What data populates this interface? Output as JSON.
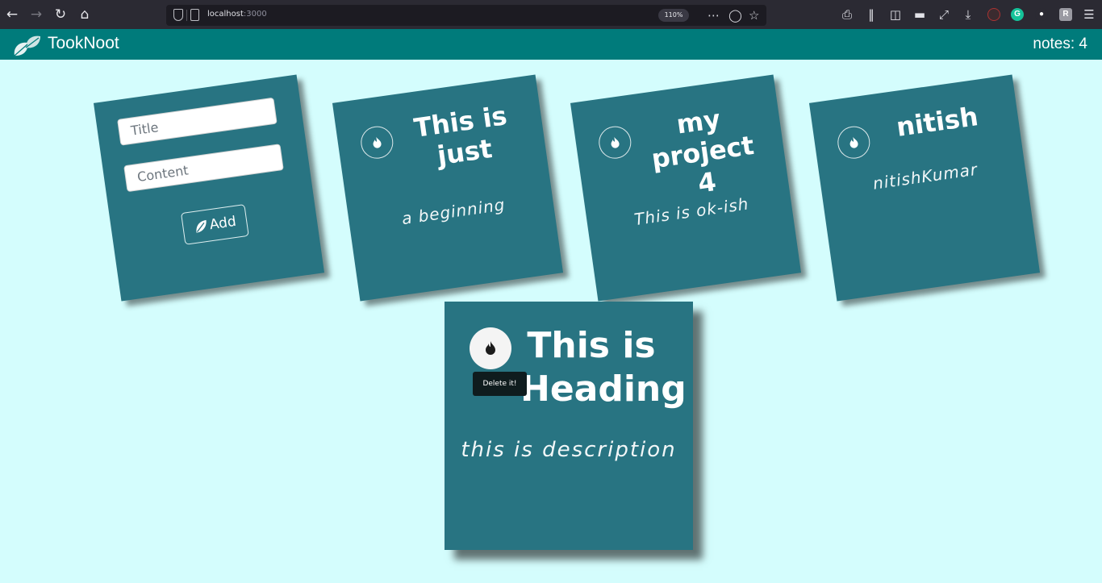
{
  "browser": {
    "url_host": "localhost",
    "url_port": ":3000",
    "zoom": "110%"
  },
  "app": {
    "title": "TookNoot",
    "notes_count": "notes: 4",
    "header_color": "#007b7b",
    "card_color": "#287482",
    "background_color": "#d4fdfd"
  },
  "form": {
    "title_placeholder": "Title",
    "content_placeholder": "Content",
    "add_label": "Add"
  },
  "notes": [
    {
      "title": "This is just",
      "content": "a beginning"
    },
    {
      "title": "my project 4",
      "content": "This is ok-ish"
    },
    {
      "title": "nitish",
      "content": "nitishKumar"
    },
    {
      "title": "This is Heading",
      "content": "this is description"
    }
  ],
  "tooltip": "Delete it!"
}
